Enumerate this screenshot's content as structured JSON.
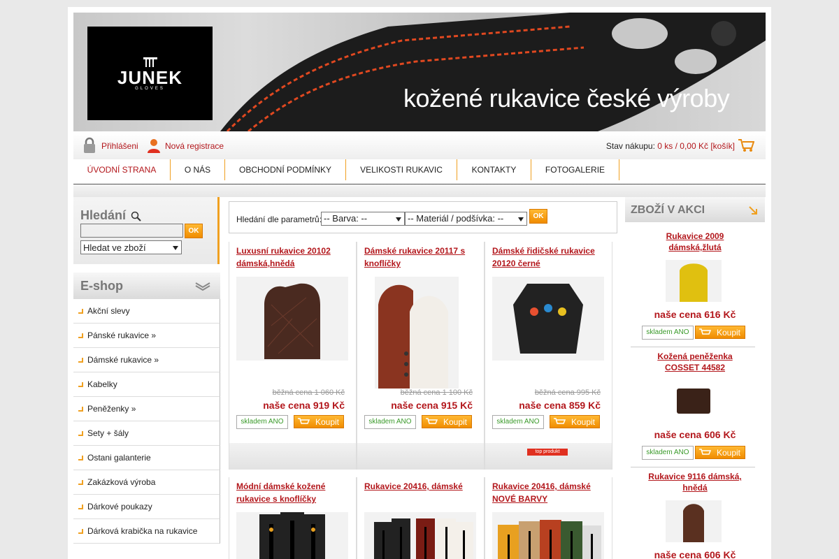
{
  "header": {
    "logo_text": "JUNEK",
    "logo_sub": "GLOVES",
    "slogan": "kožené rukavice české výroby"
  },
  "userbar": {
    "login": "Přihlášeni",
    "register": "Nová registrace",
    "cart_label": "Stav nákupu:",
    "cart_value": "0 ks / 0,00 Kč [košík]"
  },
  "nav": [
    {
      "label": "ÚVODNÍ STRANA"
    },
    {
      "label": "O NÁS"
    },
    {
      "label": "OBCHODNÍ PODMÍNKY"
    },
    {
      "label": "VELIKOSTI RUKAVIC"
    },
    {
      "label": "KONTAKTY"
    },
    {
      "label": "FOTOGALERIE"
    }
  ],
  "search": {
    "title": "Hledání",
    "ok": "OK",
    "scope": "Hledat ve zboží"
  },
  "eshop": {
    "title": "E-shop",
    "items": [
      {
        "label": "Akční slevy"
      },
      {
        "label": "Pánské rukavice »"
      },
      {
        "label": "Dámské rukavice »"
      },
      {
        "label": "Kabelky"
      },
      {
        "label": "Peněženky »"
      },
      {
        "label": "Sety + šály"
      },
      {
        "label": "Ostani galanterie"
      },
      {
        "label": "Zakázková výroba"
      },
      {
        "label": "Dárkové poukazy"
      },
      {
        "label": "Dárková krabička na rukavice"
      }
    ]
  },
  "params": {
    "label": "Hledání dle parametrů:",
    "color": "-- Barva: --",
    "material": "-- Materiál / podšívka: --",
    "ok": "OK"
  },
  "products": [
    {
      "name": "Luxusní rukavice 20102 dámská,hnědá",
      "old": "běžná cena 1 060 Kč",
      "price": "naše cena 919 Kč",
      "stock": "skladem ANO",
      "buy": "Koupit",
      "colors": [
        "#4a2a20",
        "#6b3a2c"
      ]
    },
    {
      "name": "Dámské rukavice 20117 s knoflíčky",
      "old": "běžná cena 1 100 Kč",
      "price": "naše cena 915 Kč",
      "stock": "skladem ANO",
      "buy": "Koupit",
      "colors": [
        "#8a3420",
        "#f2eee8"
      ]
    },
    {
      "name": "Dámské řidičské rukavice 20120 černé",
      "old": "běžná cena 995 Kč",
      "price": "naše cena 859 Kč",
      "stock": "skladem ANO",
      "buy": "Koupit",
      "badge": "top produkt",
      "colors": [
        "#222",
        "#e85030"
      ]
    },
    {
      "name": "Módní dámské kožené rukavice s knoflíčky",
      "colors": [
        "#222",
        "#e8a020"
      ]
    },
    {
      "name": "Rukavice 20416, dámské",
      "colors": [
        "#222",
        "#7a1c14"
      ]
    },
    {
      "name": "Rukavice 20416, dámské NOVÉ BARVY",
      "colors": [
        "#e8a020",
        "#c8a070"
      ]
    }
  ],
  "akce": {
    "title": "ZBOŽÍ V AKCI",
    "items": [
      {
        "name": "Rukavice 2009 dámská,žlutá",
        "price": "naše cena 616 Kč",
        "stock": "skladem ANO",
        "buy": "Koupit",
        "color": "#e0c010"
      },
      {
        "name": "Kožená peněženka COSSET 44582",
        "price": "naše cena 606 Kč",
        "stock": "skladem ANO",
        "buy": "Koupit",
        "color": "#3a2218"
      },
      {
        "name": "Rukavice 9116 dámská, hnědá",
        "price": "naše cena 606 Kč",
        "color": "#5a3020"
      }
    ]
  }
}
